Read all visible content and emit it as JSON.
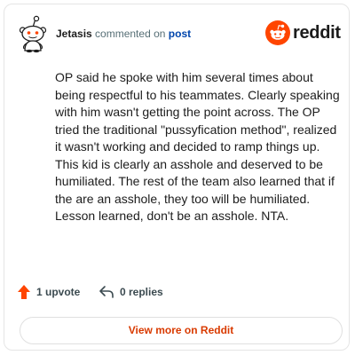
{
  "comment": {
    "username": "Jetasis",
    "action_text": "commented on",
    "post_link": "post",
    "body": "OP said he spoke with him several times about being respectful to his teammates. Clearly speaking with him wasn't getting the point across. The OP tried the traditional \"pussyfication method\", realized it wasn't working and decided to ramp things up. This kid is clearly an asshole and deserved to be humiliated. The rest of the team also learned that if the are an asshole, they too will be humiliated. Lesson learned, don't be an asshole. NTA."
  },
  "brand": {
    "logo_text": "reddit",
    "accent_color": "#ff4500",
    "logo_icon": "reddit-snoo-icon"
  },
  "actions": {
    "upvote_label": "1 upvote",
    "upvote_icon": "arrow-up-icon",
    "upvote_color": "#ff4500",
    "replies_label": "0 replies",
    "replies_icon": "reply-arrow-icon"
  },
  "footer": {
    "view_more_label": "View more on Reddit",
    "view_more_color": "#d93a00"
  }
}
